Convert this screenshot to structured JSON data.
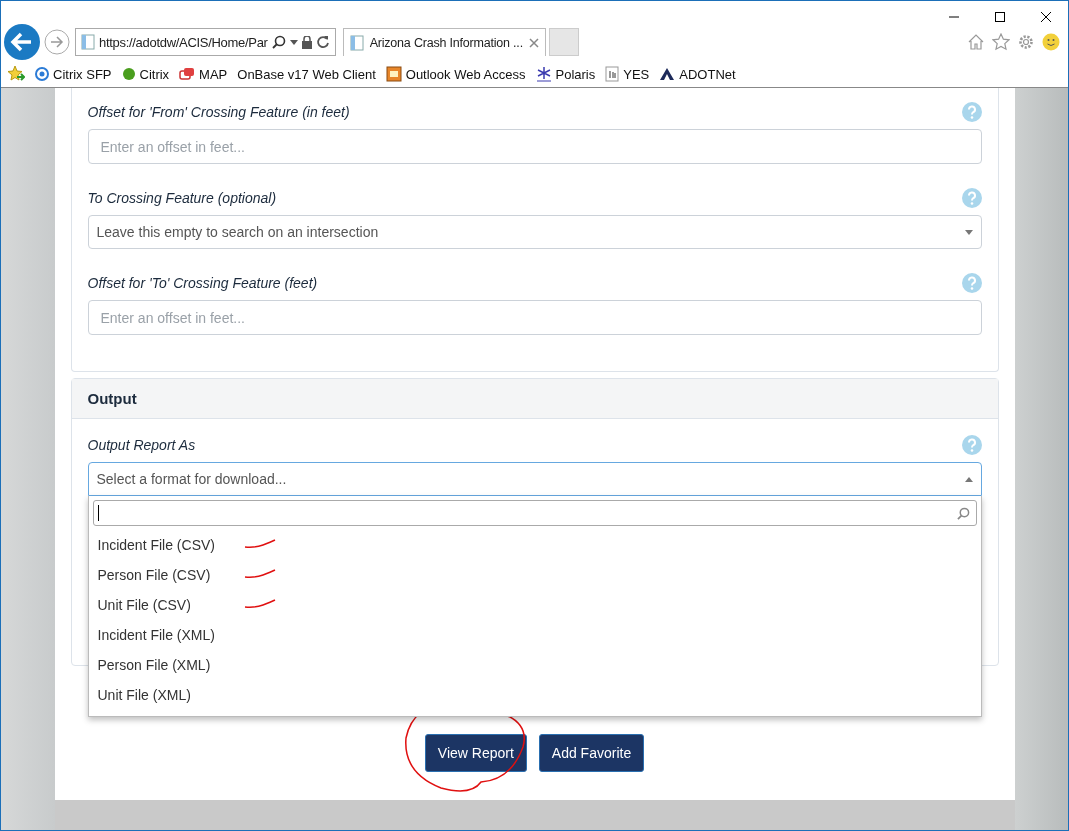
{
  "browser": {
    "address": "https://adotdw/ACIS/Home/Par",
    "tabs": [
      {
        "title": "Arizona Crash Information ...",
        "selected": true
      }
    ],
    "favorites": [
      {
        "label": "Citrix SFP",
        "kind": "ring"
      },
      {
        "label": "Citrix",
        "kind": "ball"
      },
      {
        "label": "MAP",
        "kind": "map"
      },
      {
        "label": "OnBase v17 Web Client",
        "kind": "none"
      },
      {
        "label": "Outlook Web Access",
        "kind": "mail"
      },
      {
        "label": "Polaris",
        "kind": "star"
      },
      {
        "label": "YES",
        "kind": "hand"
      },
      {
        "label": "ADOTNet",
        "kind": "logo"
      }
    ]
  },
  "filters": [
    {
      "label": "Offset for 'From' Crossing Feature (in feet)",
      "kind": "input",
      "placeholder": "Enter an offset in feet..."
    },
    {
      "label": "To Crossing Feature (optional)",
      "kind": "select",
      "placeholder": "Leave this empty to search on an intersection"
    },
    {
      "label": "Offset for 'To' Crossing Feature (feet)",
      "kind": "input",
      "placeholder": "Enter an offset in feet..."
    }
  ],
  "output": {
    "title": "Output",
    "label": "Output Report As",
    "placeholder": "Select a format for download...",
    "expanded": true,
    "options": [
      {
        "label": "Incident File (CSV)",
        "marked": true
      },
      {
        "label": "Person File (CSV)",
        "marked": true
      },
      {
        "label": "Unit File (CSV)",
        "marked": true
      },
      {
        "label": "Incident File (XML)",
        "marked": false
      },
      {
        "label": "Person File (XML)",
        "marked": false
      },
      {
        "label": "Unit File (XML)",
        "marked": false
      }
    ]
  },
  "buttons": [
    {
      "label": "View Report",
      "circled": true
    },
    {
      "label": "Add Favorite",
      "circled": false
    }
  ]
}
